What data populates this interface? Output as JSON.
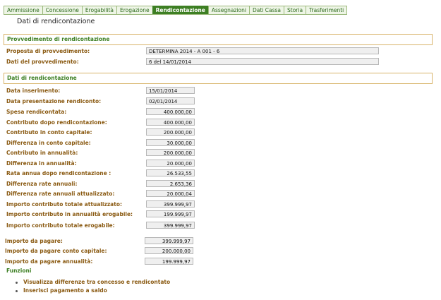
{
  "tabs": [
    "Ammissione",
    "Concessione",
    "Erogabilità",
    "Erogazione",
    "Rendicontazione",
    "Assegnazioni",
    "Dati Cassa",
    "Storia",
    "Trasferimenti"
  ],
  "active_tab": "Rendicontazione",
  "page_title": "Dati di rendicontazione",
  "provvedimento": {
    "section_title": "Provvedimento di rendicontazione",
    "proposta_label": "Proposta di provvedimento:",
    "proposta_value": "DETERMINA 2014 - A 001 - 6",
    "dati_label": "Dati del provvedimento:",
    "dati_value": "6 del 14/01/2014"
  },
  "rendicontazione": {
    "section_title": "Dati di rendicontazione",
    "rows": [
      {
        "label": "Data inserimento:",
        "value": "15/01/2014"
      },
      {
        "label": "Data presentazione rendiconto:",
        "value": "02/01/2014"
      },
      {
        "label": "Spesa rendicontata:",
        "value": "400.000,00"
      },
      {
        "label": "Contributo dopo rendicontazione:",
        "value": "400.000,00"
      },
      {
        "label": "Contributo in conto capitale:",
        "value": "200.000,00"
      },
      {
        "label": "Differenza in conto capitale:",
        "value": "30.000,00"
      },
      {
        "label": "Contributo in annualità:",
        "value": "200.000,00"
      },
      {
        "label": "Differenza in annualità:",
        "value": "20.000,00"
      },
      {
        "label": "Rata annua dopo rendicontazione :",
        "value": "26.533,55"
      },
      {
        "label": "Differenza rate annuali:",
        "value": "2.653,36"
      },
      {
        "label": "Differenza rate annuali attualizzato:",
        "value": "20.000,04"
      },
      {
        "label": "Importo contributo totale attualizzato:",
        "value": "399.999,97"
      },
      {
        "label": "Importo contributo in annualità erogabile:",
        "value": "199.999,97"
      },
      {
        "label": "Importo contributo totale erogabile:",
        "value": "399.999,97"
      }
    ]
  },
  "pagamenti": [
    {
      "label": "Importo da pagare:",
      "value": "399.999,97"
    },
    {
      "label": "Importo da pagare conto capitale:",
      "value": "200.000,00"
    },
    {
      "label": "Importo da pagare annualità:",
      "value": "199.999,97"
    }
  ],
  "funzioni": {
    "title": "Funzioni",
    "items": [
      "Visualizza differenze tra concesso e rendicontato",
      "Inserisci pagamento a saldo"
    ]
  }
}
